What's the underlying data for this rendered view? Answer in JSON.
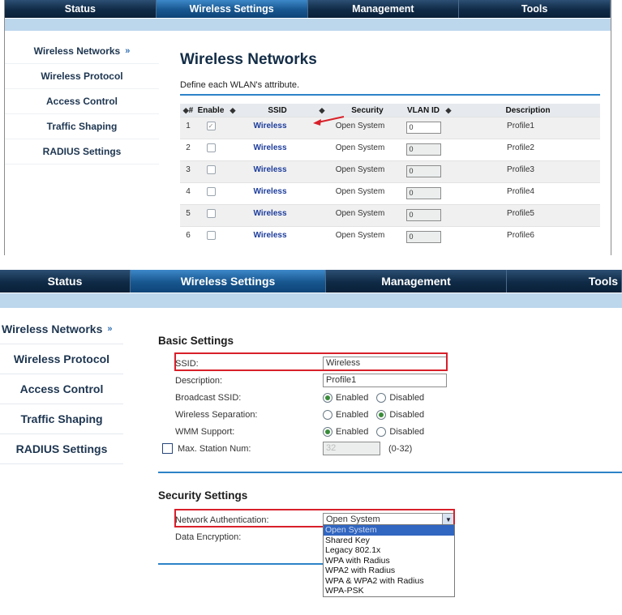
{
  "top_nav": [
    "Status",
    "Wireless Settings",
    "Management",
    "Tools"
  ],
  "active_tab": "Wireless Settings",
  "sidebar": [
    {
      "label": "Wireless Networks",
      "arrow": "»"
    },
    {
      "label": "Wireless Protocol"
    },
    {
      "label": "Access Control"
    },
    {
      "label": "Traffic Shaping"
    },
    {
      "label": "RADIUS Settings"
    }
  ],
  "networks_page": {
    "title": "Wireless Networks",
    "description": "Define each WLAN's attribute.",
    "columns": [
      "#",
      "Enable",
      "SSID",
      "Security",
      "VLAN ID",
      "Description"
    ],
    "rows": [
      {
        "num": "1",
        "enabled": true,
        "ssid": "Wireless",
        "security": "Open System",
        "vlan": "0",
        "desc": "Profile1"
      },
      {
        "num": "2",
        "enabled": false,
        "ssid": "Wireless",
        "security": "Open System",
        "vlan": "0",
        "desc": "Profile2"
      },
      {
        "num": "3",
        "enabled": false,
        "ssid": "Wireless",
        "security": "Open System",
        "vlan": "0",
        "desc": "Profile3"
      },
      {
        "num": "4",
        "enabled": false,
        "ssid": "Wireless",
        "security": "Open System",
        "vlan": "0",
        "desc": "Profile4"
      },
      {
        "num": "5",
        "enabled": false,
        "ssid": "Wireless",
        "security": "Open System",
        "vlan": "0",
        "desc": "Profile5"
      },
      {
        "num": "6",
        "enabled": false,
        "ssid": "Wireless",
        "security": "Open System",
        "vlan": "0",
        "desc": "Profile6"
      }
    ]
  },
  "basic_settings": {
    "title": "Basic Settings",
    "ssid_label": "SSID:",
    "ssid_value": "Wireless",
    "description_label": "Description:",
    "description_value": "Profile1",
    "broadcast_label": "Broadcast SSID:",
    "separation_label": "Wireless Separation:",
    "wmm_label": "WMM Support:",
    "enabled_label": "Enabled",
    "disabled_label": "Disabled",
    "max_station_label": "Max. Station Num:",
    "max_station_value": "32",
    "max_station_range": "(0-32)"
  },
  "security_settings": {
    "title": "Security Settings",
    "auth_label": "Network Authentication:",
    "auth_value": "Open System",
    "encryption_label": "Data Encryption:",
    "auth_options": [
      "Open System",
      "Shared Key",
      "Legacy 802.1x",
      "WPA with Radius",
      "WPA2 with Radius",
      "WPA & WPA2 with Radius",
      "WPA-PSK"
    ]
  },
  "colors": {
    "highlight_red": "#d8202a",
    "nav_dark": "#0f2a46",
    "nav_active": "#17568f",
    "accent_blue": "#2d83c7"
  }
}
